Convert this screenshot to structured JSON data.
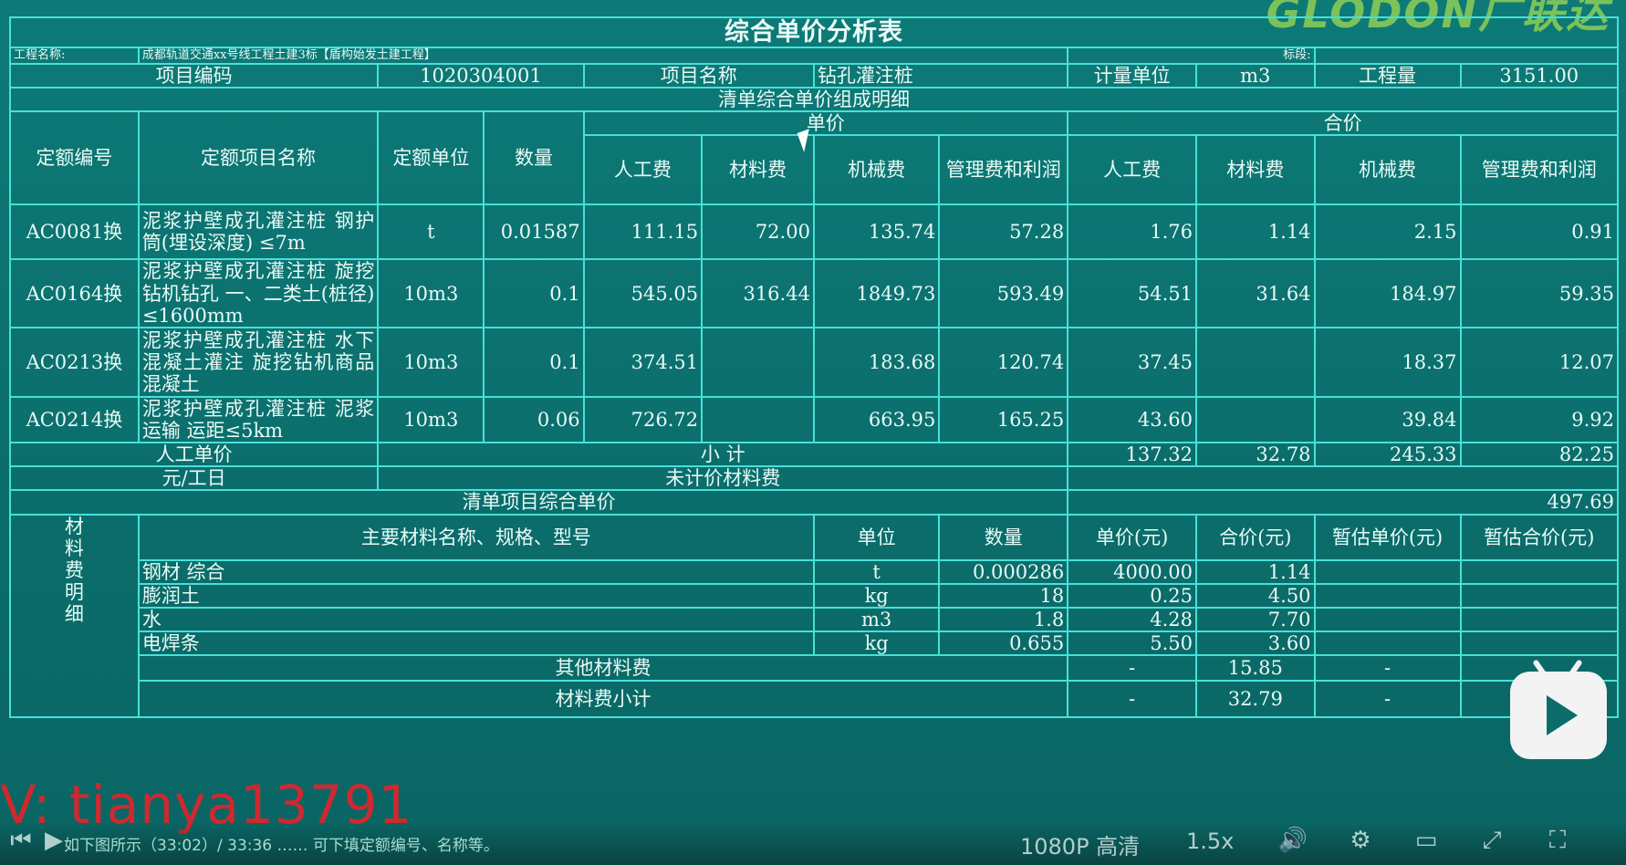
{
  "title": "综合单价分析表",
  "logo": "GLODON广联达",
  "project": {
    "name_label": "工程名称:",
    "name_value": "成都轨道交通xx号线工程土建3标【盾构始发土建工程】",
    "section_label": "标段:",
    "section_value": ""
  },
  "item": {
    "code_label": "项目编码",
    "code_value": "1020304001",
    "name_label": "项目名称",
    "name_value": "钻孔灌注桩",
    "unit_label": "计量单位",
    "unit_value": "m3",
    "qty_label": "工程量",
    "qty_value": "3151.00"
  },
  "detail_heading": "清单综合单价组成明细",
  "headers": {
    "quota_code": "定额编号",
    "quota_name": "定额项目名称",
    "quota_unit": "定额单位",
    "quantity": "数量",
    "unit_price": "单价",
    "total_price": "合价",
    "labor": "人工费",
    "material": "材料费",
    "machine": "机械费",
    "mgmt": "管理费和利润"
  },
  "rows": [
    {
      "code": "AC0081换",
      "name": "泥浆护壁成孔灌注桩 钢护筒(埋设深度) ≤7m",
      "unit": "t",
      "qty": "0.01587",
      "u_labor": "111.15",
      "u_material": "72.00",
      "u_machine": "135.74",
      "u_mgmt": "57.28",
      "t_labor": "1.76",
      "t_material": "1.14",
      "t_machine": "2.15",
      "t_mgmt": "0.91"
    },
    {
      "code": "AC0164换",
      "name": "泥浆护壁成孔灌注桩 旋挖钻机钻孔 一、二类土(桩径) ≤1600mm",
      "unit": "10m3",
      "qty": "0.1",
      "u_labor": "545.05",
      "u_material": "316.44",
      "u_machine": "1849.73",
      "u_mgmt": "593.49",
      "t_labor": "54.51",
      "t_material": "31.64",
      "t_machine": "184.97",
      "t_mgmt": "59.35"
    },
    {
      "code": "AC0213换",
      "name": "泥浆护壁成孔灌注桩 水下混凝土灌注 旋挖钻机商品混凝土",
      "unit": "10m3",
      "qty": "0.1",
      "u_labor": "374.51",
      "u_material": "",
      "u_machine": "183.68",
      "u_mgmt": "120.74",
      "t_labor": "37.45",
      "t_material": "",
      "t_machine": "18.37",
      "t_mgmt": "12.07"
    },
    {
      "code": "AC0214换",
      "name": "泥浆护壁成孔灌注桩 泥浆运输 运距≤5km",
      "unit": "10m3",
      "qty": "0.06",
      "u_labor": "726.72",
      "u_material": "",
      "u_machine": "663.95",
      "u_mgmt": "165.25",
      "t_labor": "43.60",
      "t_material": "",
      "t_machine": "39.84",
      "t_mgmt": "9.92"
    }
  ],
  "summary": {
    "labor_unit_label": "人工单价",
    "subtotal_label": "小 计",
    "sub_labor": "137.32",
    "sub_material": "32.78",
    "sub_machine": "245.33",
    "sub_mgmt": "82.25",
    "yuan_per_day": "元/工日",
    "unpriced_label": "未计价材料费",
    "unpriced_value": "",
    "total_label": "清单项目综合单价",
    "total_value": "497.69"
  },
  "materials": {
    "side_label_chars": [
      "材",
      "料",
      "费",
      "明",
      "细"
    ],
    "name_header": "主要材料名称、规格、型号",
    "unit_header": "单位",
    "qty_header": "数量",
    "price_header": "单价(元)",
    "total_header": "合价(元)",
    "est_price_header": "暂估单价(元)",
    "est_total_header": "暂估合价(元)",
    "rows": [
      {
        "name": "钢材 综合",
        "unit": "t",
        "qty": "0.000286",
        "price": "4000.00",
        "total": "1.14",
        "est_price": "",
        "est_total": ""
      },
      {
        "name": "膨润土",
        "unit": "kg",
        "qty": "18",
        "price": "0.25",
        "total": "4.50",
        "est_price": "",
        "est_total": ""
      },
      {
        "name": "水",
        "unit": "m3",
        "qty": "1.8",
        "price": "4.28",
        "total": "7.70",
        "est_price": "",
        "est_total": ""
      },
      {
        "name": "电焊条",
        "unit": "kg",
        "qty": "0.655",
        "price": "5.50",
        "total": "3.60",
        "est_price": "",
        "est_total": ""
      }
    ],
    "other_label": "其他材料费",
    "other_price": "-",
    "other_total": "15.85",
    "other_est": "-",
    "subtotal_label": "材料费小计",
    "subtotal_price": "-",
    "subtotal_total": "32.79",
    "subtotal_est": "-"
  },
  "overlay": {
    "watermark": "V: tianya13791",
    "hint": "如下图所示（33:02）/ 33:36 ……  可下填定额编号、名称等。",
    "quality": "1080P 高清",
    "speed": "1.5x"
  }
}
